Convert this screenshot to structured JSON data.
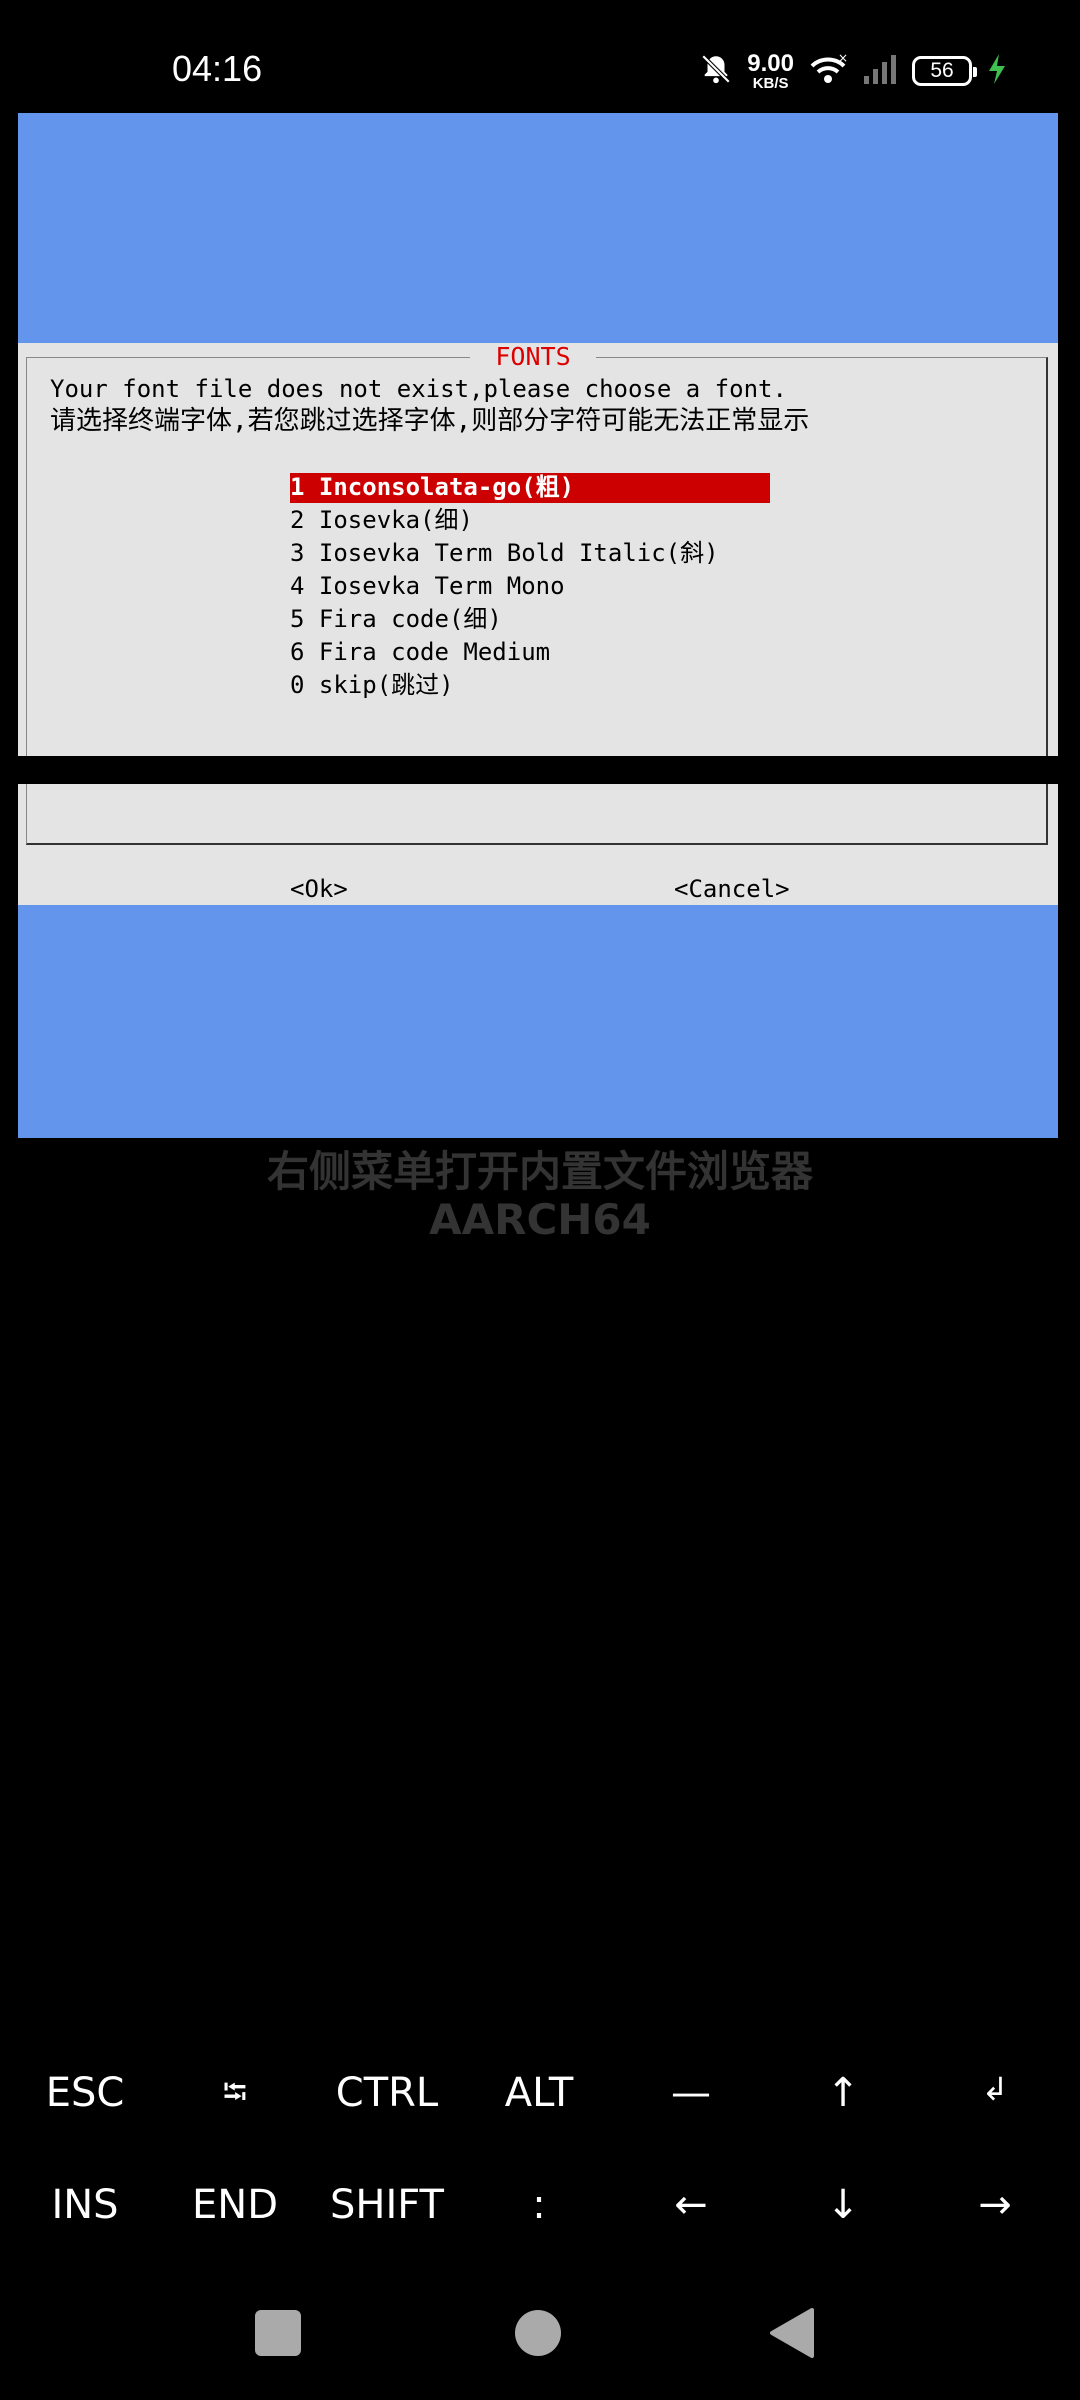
{
  "status_bar": {
    "time": "04:16",
    "net_speed_value": "9.00",
    "net_speed_unit": "KB/S",
    "battery_level": "56",
    "icons": [
      "bell-off-icon",
      "wifi-icon",
      "signal-icon",
      "battery-icon",
      "charging-icon"
    ]
  },
  "dialog": {
    "title": "FONTS",
    "message_en": "Your font file does not exist,please choose a font.",
    "message_zh": "请选择终端字体,若您跳过选择字体,则部分字符可能无法正常显示",
    "options": [
      "1 Inconsolata-go(粗)",
      "2 Iosevka(细)",
      "3 Iosevka Term Bold Italic(斜)",
      "4 Iosevka Term Mono",
      "5 Fira code(细)",
      "6 Fira code Medium",
      "0 skip(跳过)"
    ],
    "selected_index": 0,
    "ok_label": "<Ok>",
    "cancel_label": "<Cancel>"
  },
  "background_text": {
    "line2": "右侧菜单打开内置文件浏览器",
    "line3": "AARCH64"
  },
  "extra_keys": {
    "row1": [
      "ESC",
      "⭾",
      "CTRL",
      "ALT",
      "—",
      "↑",
      "↲"
    ],
    "row2": [
      "INS",
      "END",
      "SHIFT",
      ":",
      "←",
      "↓",
      "→"
    ]
  },
  "colors": {
    "terminal_blue": "#6495ec",
    "dialog_bg": "#e4e4e4",
    "selection_red": "#cc0000",
    "title_red": "#dd0000"
  }
}
